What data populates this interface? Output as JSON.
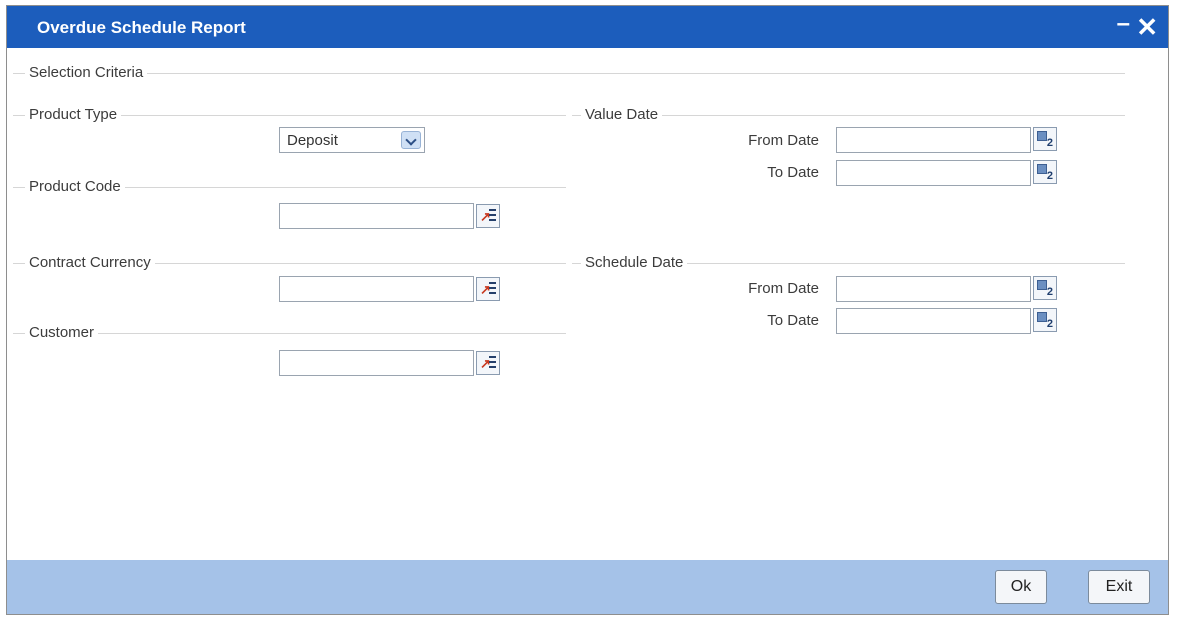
{
  "window": {
    "title": "Overdue Schedule Report",
    "minimize_glyph": "–",
    "close_glyph": "✕"
  },
  "sections": {
    "selection_criteria": "Selection Criteria",
    "product_type": "Product Type",
    "product_code": "Product Code",
    "contract_currency": "Contract Currency",
    "customer": "Customer",
    "value_date": "Value Date",
    "schedule_date": "Schedule Date"
  },
  "product_type": {
    "selected": "Deposit",
    "icon": "chevron-down-icon"
  },
  "product_code": {
    "value": "",
    "lov_icon": "list-of-values-icon"
  },
  "contract_currency": {
    "value": "",
    "lov_icon": "list-of-values-icon"
  },
  "customer": {
    "value": "",
    "lov_icon": "list-of-values-icon"
  },
  "value_date": {
    "from_label": "From Date",
    "to_label": "To Date",
    "from_value": "",
    "to_value": "",
    "calendar_icon": "calendar-icon"
  },
  "schedule_date": {
    "from_label": "From Date",
    "to_label": "To Date",
    "from_value": "",
    "to_value": "",
    "calendar_icon": "calendar-icon"
  },
  "footer": {
    "ok_label": "Ok",
    "exit_label": "Exit"
  },
  "colors": {
    "titlebar": "#1c5dbc",
    "footer": "#a5c2e8",
    "title_text": "#ffffff"
  }
}
